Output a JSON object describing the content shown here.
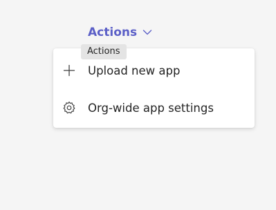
{
  "actions_menu": {
    "trigger_label": "Actions",
    "trigger_icon": "chevron-down-icon",
    "tooltip": "Actions",
    "items": [
      {
        "label": "Upload new app",
        "icon": "plus-icon"
      },
      {
        "label": "Org-wide app settings",
        "icon": "gear-icon"
      }
    ]
  },
  "colors": {
    "accent": "#5b5fc7",
    "text": "#242424",
    "background": "#f5f5f5",
    "menu_background": "#ffffff",
    "tooltip_background": "#e4e4e4"
  }
}
